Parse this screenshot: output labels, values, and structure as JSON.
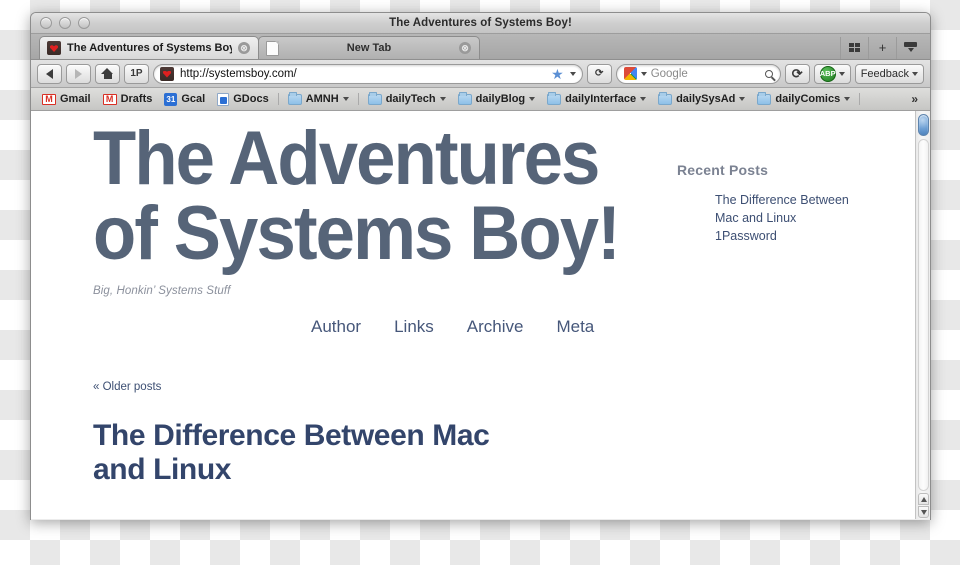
{
  "window": {
    "title": "The Adventures of Systems Boy!",
    "traffic_lights": [
      "close",
      "minimize",
      "zoom"
    ]
  },
  "tabs": [
    {
      "label": "The Adventures of Systems Boy!",
      "icon": "systemsboy-favicon",
      "active": true,
      "close": "⊗"
    },
    {
      "label": "New Tab",
      "icon": "blank-page-icon",
      "active": false,
      "close": "⊗"
    }
  ],
  "tab_tools": {
    "list_all_tabs_icon": "grid-icon",
    "new_tab_label": "+",
    "downloads_icon": "download-icon"
  },
  "toolbar": {
    "back_label": "Back",
    "forward_label": "Forward",
    "home_label": "Home",
    "onepassword_label": "1P",
    "url": "http://systemsboy.com/",
    "url_favicon": "systemsboy-favicon",
    "bookmark_star": "★",
    "reload_label": "⟳",
    "search_engine": "Google",
    "search_placeholder": "Google",
    "sync_label": "⟳",
    "adblock_label": "ABP",
    "feedback_label": "Feedback"
  },
  "bookmarks": [
    {
      "label": "Gmail",
      "icon": "gmail-icon"
    },
    {
      "label": "Drafts",
      "icon": "gmail-icon"
    },
    {
      "label": "Gcal",
      "icon": "calendar-icon",
      "badge": "31"
    },
    {
      "label": "GDocs",
      "icon": "gdocs-icon"
    },
    {
      "label": "AMNH",
      "icon": "folder-icon",
      "dropdown": true
    },
    {
      "label": "dailyTech",
      "icon": "folder-icon",
      "dropdown": true
    },
    {
      "label": "dailyBlog",
      "icon": "folder-icon",
      "dropdown": true
    },
    {
      "label": "dailyInterface",
      "icon": "folder-icon",
      "dropdown": true
    },
    {
      "label": "dailySysAd",
      "icon": "folder-icon",
      "dropdown": true
    },
    {
      "label": "dailyComics",
      "icon": "folder-icon",
      "dropdown": true
    }
  ],
  "bookmarks_overflow": "»",
  "page": {
    "site_title": "The Adventures\nof Systems Boy!",
    "tagline": "Big, Honkin’ Systems Stuff",
    "nav": [
      "Author",
      "Links",
      "Archive",
      "Meta"
    ],
    "older_posts": "« Older posts",
    "post_title": "The Difference Between Mac\nand Linux",
    "sidebar": {
      "heading": "Recent Posts",
      "items": [
        "The Difference Between\nMac and Linux",
        "1Password"
      ]
    }
  },
  "scrollbar": {
    "up_arrow": "▲",
    "down_arrow": "▼"
  },
  "colors": {
    "site_title": "#566478",
    "post_title": "#33456b",
    "nav_link": "#46577a",
    "tagline": "#8b909c",
    "sidebar_heading": "#7b8292"
  }
}
